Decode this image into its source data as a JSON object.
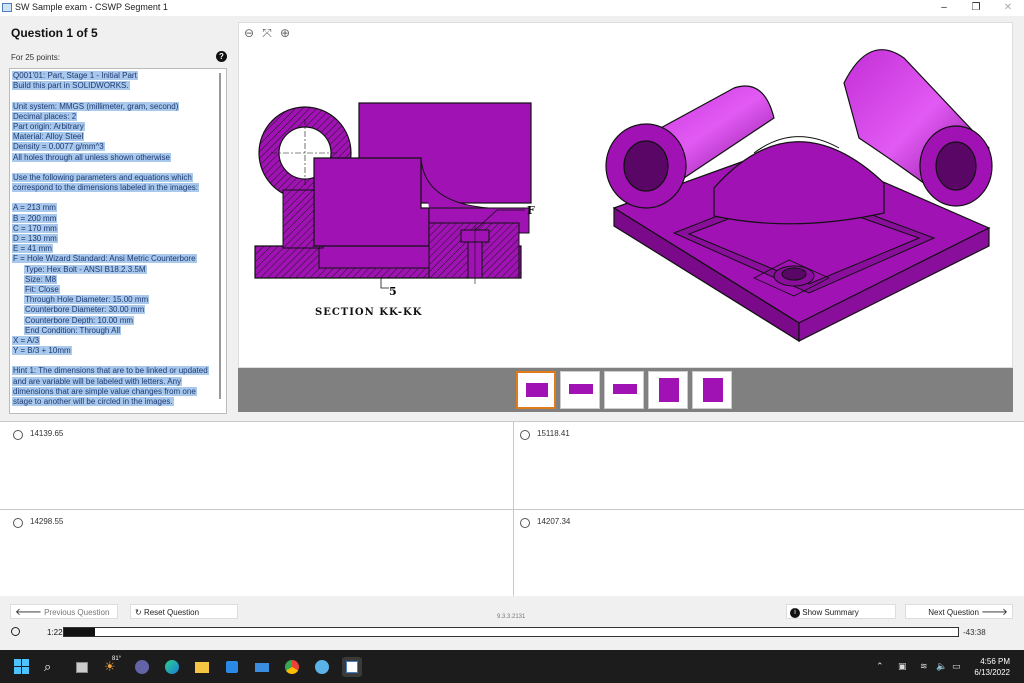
{
  "window": {
    "title": "SW Sample exam - CSWP Segment 1",
    "minimize": "–",
    "maximize": "❐",
    "close": "✕"
  },
  "question": {
    "title": "Question 1 of 5",
    "points": "For 25 points:",
    "help": "?",
    "text_lines": [
      {
        "t": "Q001'01: Part, Stage 1 - Initial Part"
      },
      {
        "t": "Build this part in SOLIDWORKS."
      },
      {
        "gap": true
      },
      {
        "t": "Unit system: MMGS (millimeter, gram, second)"
      },
      {
        "t": "Decimal places: 2"
      },
      {
        "t": "Part origin: Arbitrary"
      },
      {
        "t": "Material: Alloy Steel"
      },
      {
        "t": "Density = 0.0077 g/mm^3"
      },
      {
        "t": "All holes through all unless shown otherwise"
      },
      {
        "gap": true
      },
      {
        "t": "Use the following parameters and equations which"
      },
      {
        "t": "correspond to the dimensions labeled in the images:"
      },
      {
        "gap": true
      },
      {
        "t": "A = 213 mm"
      },
      {
        "t": "B = 200 mm"
      },
      {
        "t": "C = 170 mm"
      },
      {
        "t": "D = 130 mm"
      },
      {
        "t": "E = 41 mm"
      },
      {
        "t": "F = Hole Wizard Standard: Ansi Metric Counterbore"
      },
      {
        "t": "Type: Hex Bolt - ANSI B18.2.3.5M",
        "indent": true
      },
      {
        "t": "Size: M8",
        "indent": true
      },
      {
        "t": "Fit: Close",
        "indent": true
      },
      {
        "t": "Through Hole Diameter: 15.00 mm",
        "indent": true
      },
      {
        "t": "Counterbore Diameter: 30.00 mm",
        "indent": true
      },
      {
        "t": "Counterbore Depth: 10.00 mm",
        "indent": true
      },
      {
        "t": "End Condition: Through All",
        "indent": true
      },
      {
        "t": "X = A/3"
      },
      {
        "t": "Y = B/3 + 10mm"
      },
      {
        "gap": true
      },
      {
        "t": "Hint 1: The dimensions that are to be linked or updated"
      },
      {
        "t": "and are variable will be labeled with letters. Any"
      },
      {
        "t": "dimensions that are simple value changes from one"
      },
      {
        "t": "stage to another will be circled in the images."
      }
    ]
  },
  "viewer": {
    "zoom_out": "⊖",
    "fit": "⤧",
    "zoom_in": "⊕",
    "section_label": "SECTION KK-KK",
    "label_f": "F",
    "label_5": "5",
    "part_color": "#a012b3"
  },
  "answers": [
    {
      "label": "14139.65"
    },
    {
      "label": "15118.41"
    },
    {
      "label": "14298.55"
    },
    {
      "label": "14207.34"
    }
  ],
  "footer": {
    "prev": "Previous Question",
    "reset": "Reset Question",
    "version": "9.3.3.2131",
    "summary": "Show Summary",
    "next": "Next Question",
    "elapsed": "1:22",
    "remaining": "-43:38",
    "progress": 0.035
  },
  "taskbar": {
    "weather": "81°",
    "time": "4:56 PM",
    "date": "6/13/2022"
  }
}
